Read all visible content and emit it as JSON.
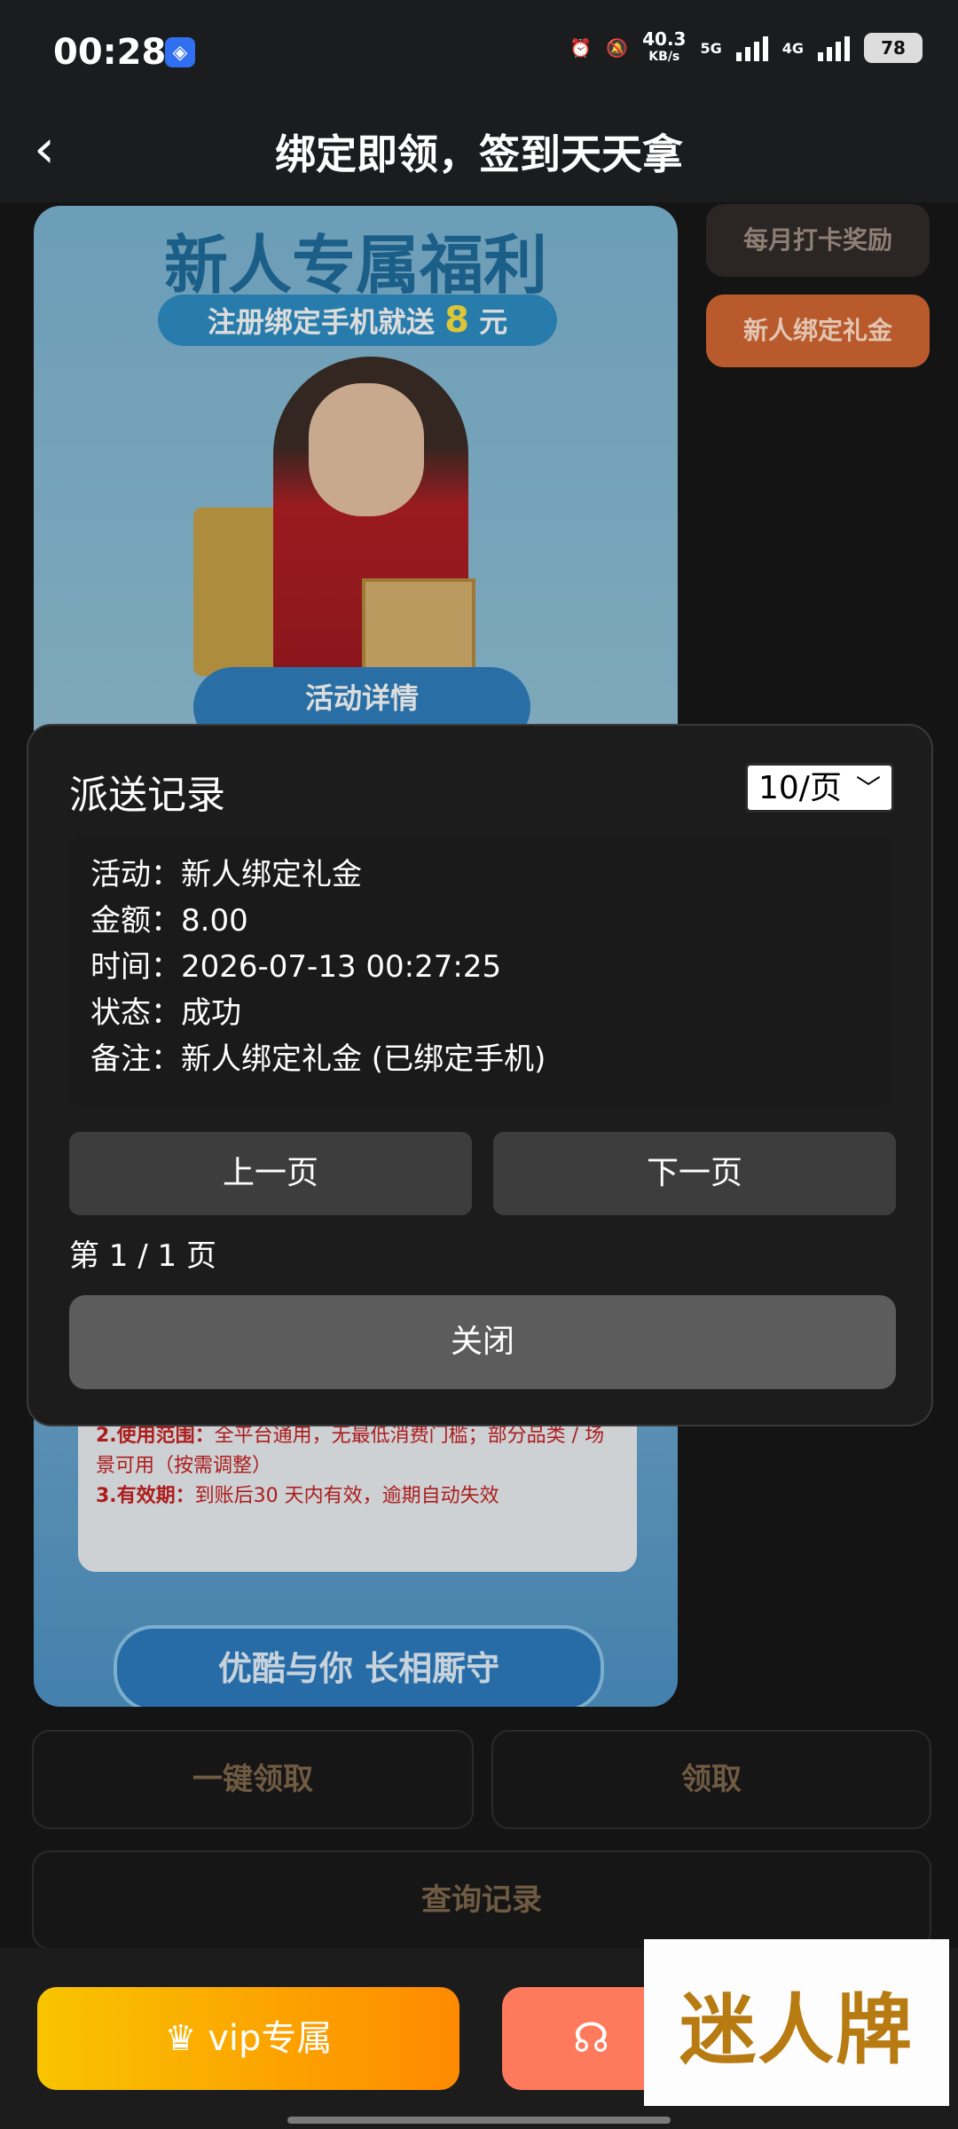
{
  "status_bar": {
    "time": "00:28",
    "net_speed_value": "40.3",
    "net_speed_unit": "KB/s",
    "sim1": "5G",
    "sim2": "4G",
    "battery": "78"
  },
  "nav": {
    "title": "绑定即领，签到天天拿"
  },
  "banner": {
    "headline": "新人专属福利",
    "subline_prefix": "注册绑定手机就送",
    "subline_amount": "8",
    "subline_unit": "元",
    "detail_label": "活动详情",
    "rules": [
      {
        "key": "2.使用范围：",
        "text": "全平台通用，无最低消费门槛；部分品类 / 场景可用（按需调整）"
      },
      {
        "key": "3.有效期：",
        "text": "到账后30 天内有效，逾期自动失效"
      }
    ],
    "slogan": "优酷与你 长相厮守"
  },
  "side_tabs": [
    "每月打卡奖励",
    "新人绑定礼金"
  ],
  "actions": {
    "claim_all": "一键领取",
    "claim": "领取",
    "query_records": "查询记录"
  },
  "bottom": {
    "vip_label": "vip专属"
  },
  "watermark": "迷人牌",
  "modal": {
    "title": "派送记录",
    "page_size": "10/页",
    "record": [
      {
        "label": "活动：",
        "value": "新人绑定礼金"
      },
      {
        "label": "金额：",
        "value": "8.00"
      },
      {
        "label": "时间：",
        "value": "2026-07-13 00:27:25"
      },
      {
        "label": "状态：",
        "value": "成功"
      },
      {
        "label": "备注：",
        "value": "新人绑定礼金 (已绑定手机)"
      }
    ],
    "prev": "上一页",
    "next": "下一页",
    "page_info": "第 1 / 1 页",
    "close": "关闭"
  }
}
